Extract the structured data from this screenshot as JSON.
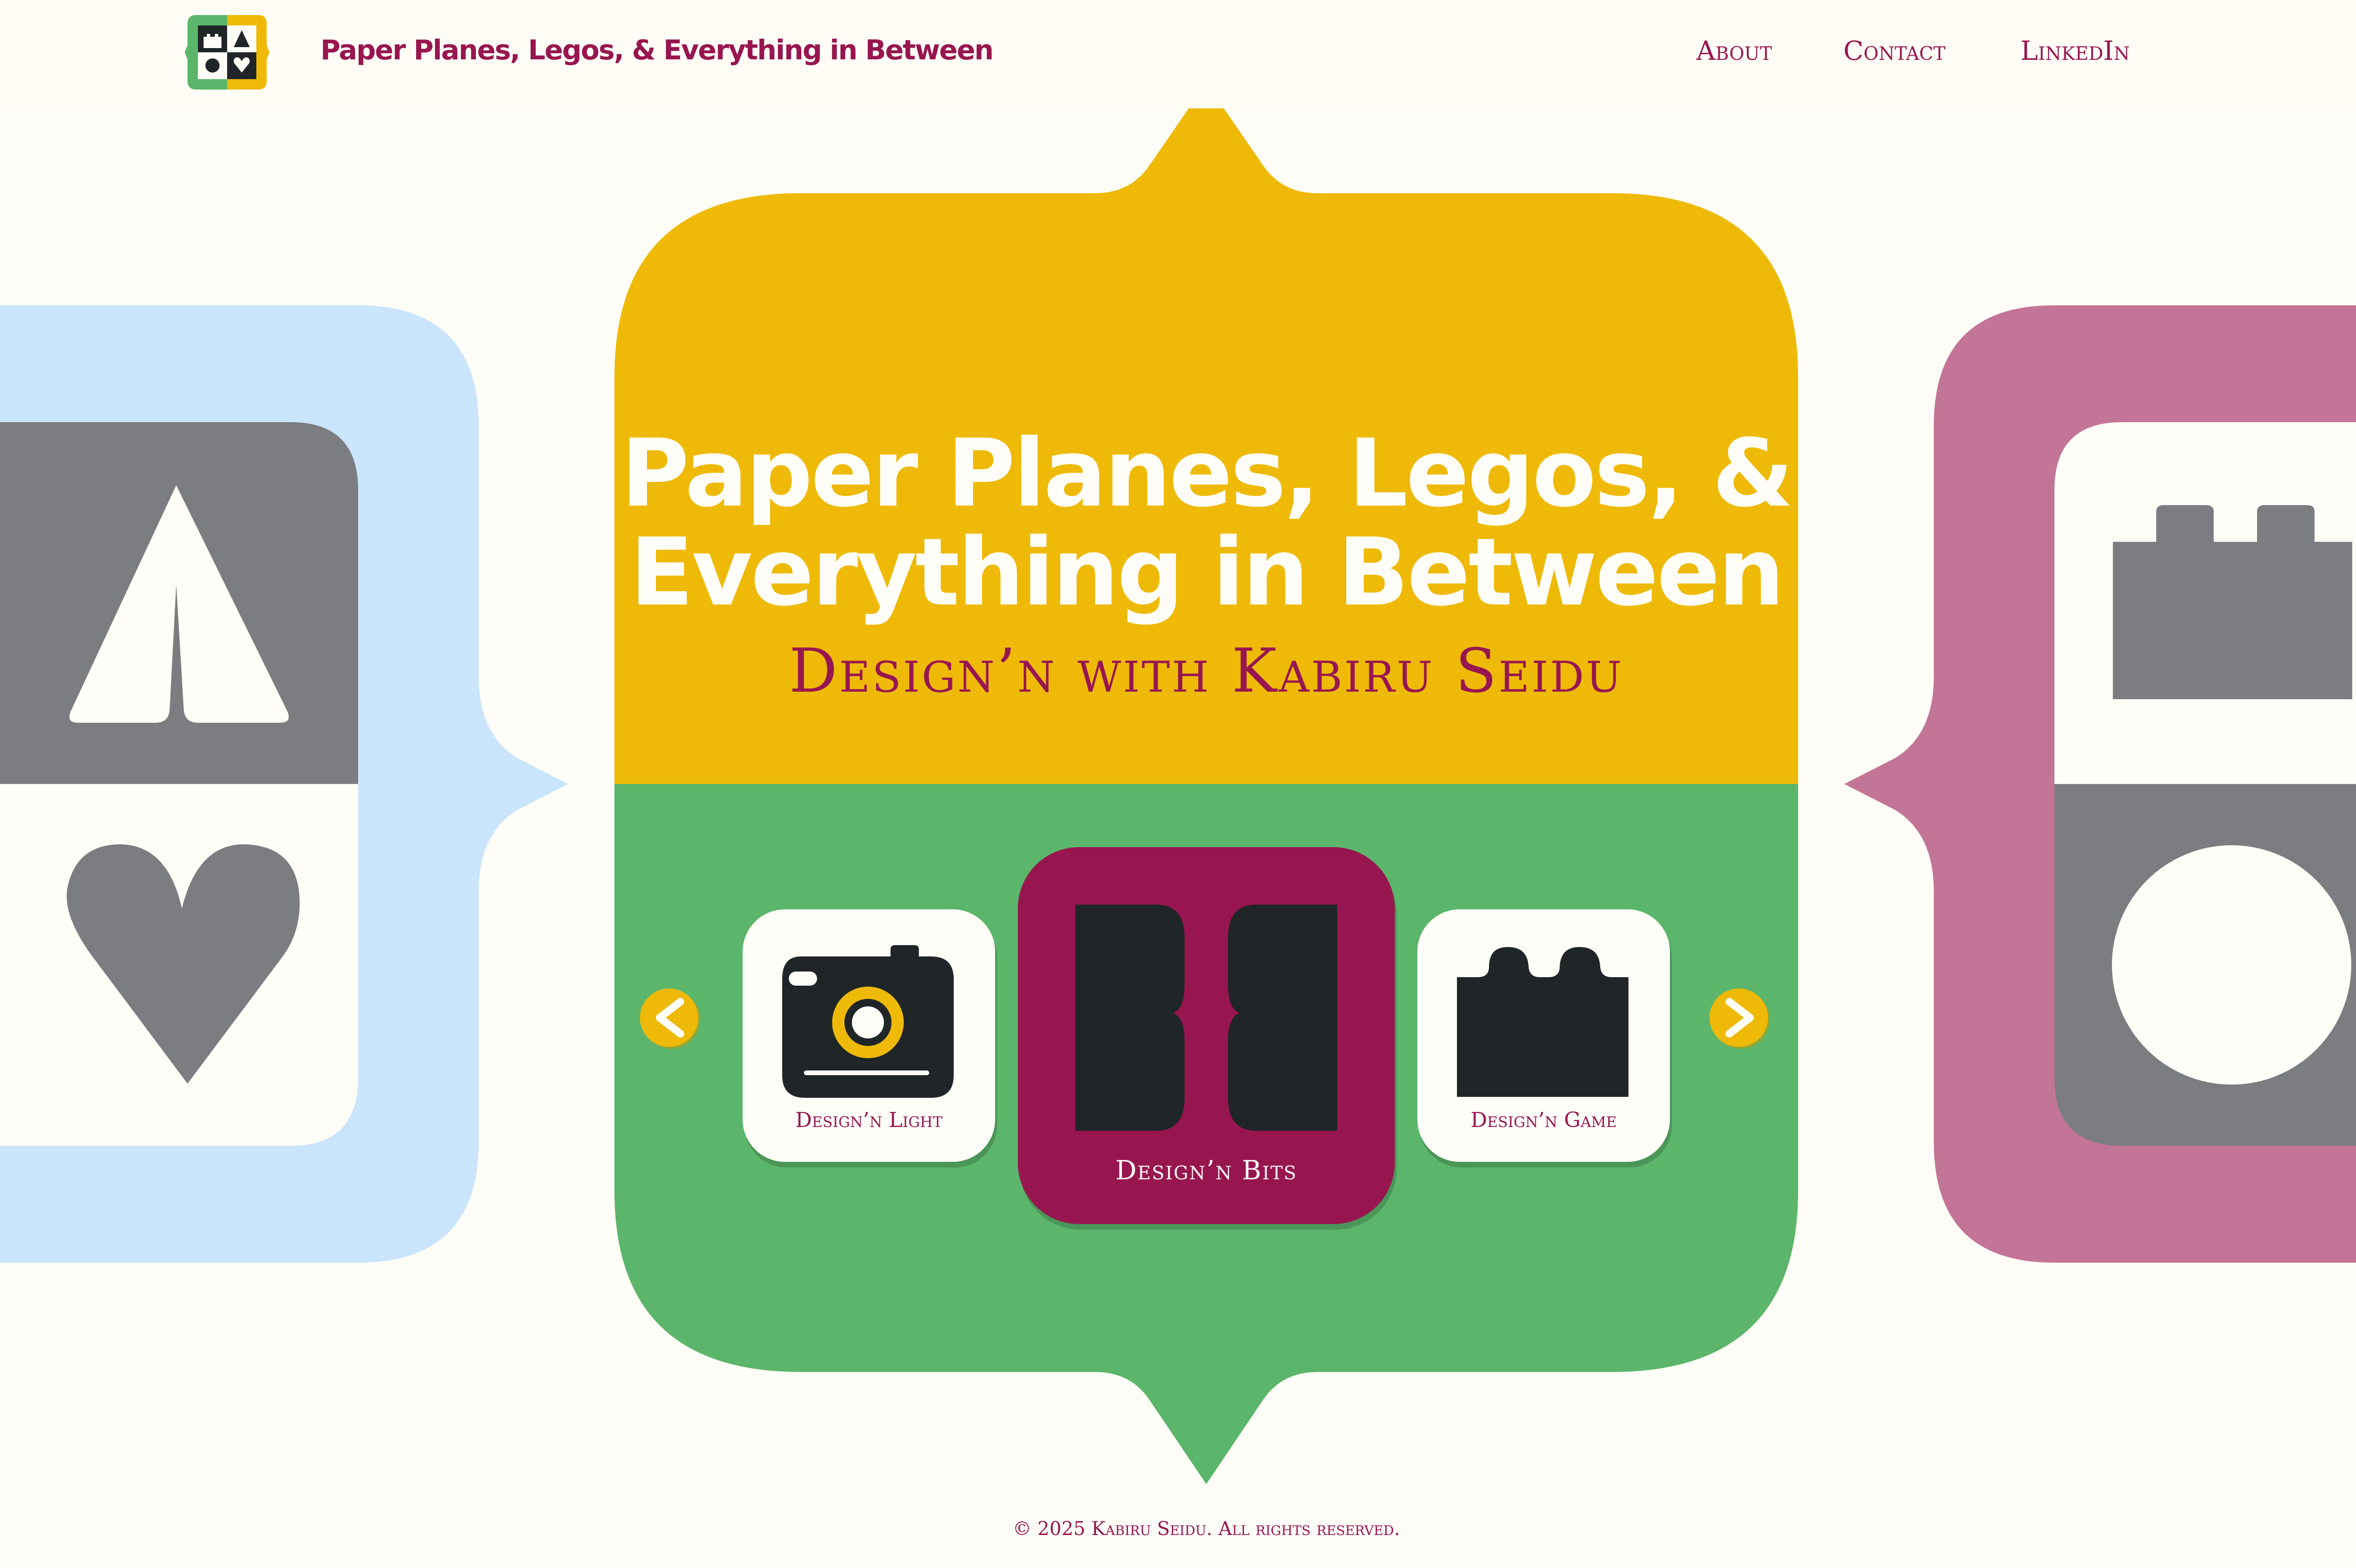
{
  "header": {
    "site_title": "Paper Planes, Legos, & Everything in Between",
    "nav": {
      "about": "About",
      "contact": "Contact",
      "linkedin": "LinkedIn"
    }
  },
  "hero": {
    "title": "Paper Planes, Legos, & Everything in Between",
    "subtitle": "Design’n with Kabiru Seidu"
  },
  "carousel": {
    "tiles": [
      {
        "label": "Design’n Light",
        "icon": "camera-icon"
      },
      {
        "label": "Design’n Bits",
        "icon": "bits-icon",
        "selected": true
      },
      {
        "label": "Design’n Game",
        "icon": "lego-brick-icon"
      }
    ],
    "prev_icon": "chevron-left-icon",
    "next_icon": "chevron-right-icon"
  },
  "side_cards": {
    "left": {
      "icons": [
        "paper-plane-icon",
        "heart-icon"
      ]
    },
    "right": {
      "icons": [
        "lego-brick-icon",
        "circle-icon"
      ]
    }
  },
  "footer": {
    "copyright": "© 2025 Kabiru Seidu. All rights reserved."
  },
  "colors": {
    "background": "#fffdf7",
    "magenta": "#981650",
    "yellow": "#eeba07",
    "green": "#5bb66b",
    "light_blue": "#cae5fc",
    "pink": "#c37597",
    "gray": "#7b7d80",
    "dark": "#202528"
  }
}
